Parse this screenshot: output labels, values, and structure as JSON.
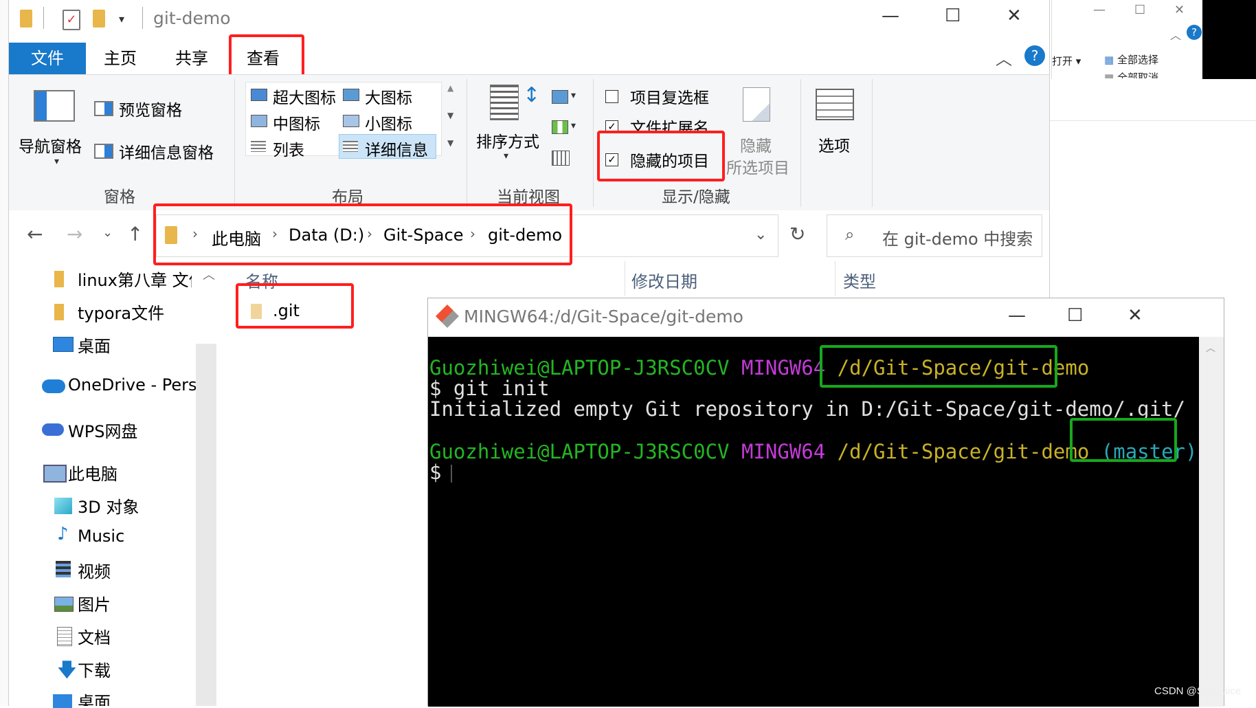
{
  "background_window": {
    "btn_open": "打开 ▾",
    "btn_select_all": "全部选择",
    "btn_deselect": "全部取消"
  },
  "explorer": {
    "title": "git-demo",
    "tabs": {
      "file": "文件",
      "home": "主页",
      "share": "共享",
      "view": "查看"
    },
    "ribbon": {
      "pane": {
        "nav_pane": "导航窗格",
        "preview_pane": "预览窗格",
        "details_pane": "详细信息窗格",
        "group_label": "窗格"
      },
      "layout": {
        "items": [
          "超大图标",
          "大图标",
          "中图标",
          "小图标",
          "列表",
          "详细信息"
        ],
        "group_label": "布局"
      },
      "current_view": {
        "sort_by": "排序方式",
        "group_label": "当前视图"
      },
      "show_hide": {
        "item_checkboxes": "项目复选框",
        "file_ext": "文件扩展名",
        "hidden_items": "隐藏的项目",
        "hide_selected_line1": "隐藏",
        "hide_selected_line2": "所选项目",
        "group_label": "显示/隐藏"
      },
      "options": {
        "label": "选项"
      }
    },
    "address": {
      "crumbs": [
        "此电脑",
        "Data (D:)",
        "Git-Space",
        "git-demo"
      ],
      "search_placeholder": "在 git-demo 中搜索"
    },
    "sidebar": {
      "items": [
        "linux第八章 文件",
        "typora文件",
        "桌面",
        "OneDrive - Perso",
        "WPS网盘",
        "此电脑",
        "3D 对象",
        "Music",
        "视频",
        "图片",
        "文档",
        "下载",
        "桌面"
      ]
    },
    "columns": {
      "name": "名称",
      "modified": "修改日期",
      "type": "类型"
    },
    "files": [
      {
        "name": ".git"
      }
    ]
  },
  "terminal": {
    "title": "MINGW64:/d/Git-Space/git-demo",
    "lines": {
      "prompt1_user": "Guozhiwei@LAPTOP-J3RSC0CV",
      "prompt1_env": "MINGW64",
      "prompt1_path": "/d/Git-Space/git-demo",
      "cmd1": "$ git init",
      "output1": "Initialized empty Git repository in D:/Git-Space/git-demo/.git/",
      "prompt2_user": "Guozhiwei@LAPTOP-J3RSC0CV",
      "prompt2_env": "MINGW64",
      "prompt2_path": "/d/Git-Space/git-demo",
      "prompt2_branch": "(master)",
      "cmd2": "$"
    }
  },
  "watermark": "CSDN @Saltyjuice",
  "colors": {
    "file_tab": "#1979ca",
    "highlight_red": "#ff1e1e",
    "highlight_green": "#17a81d",
    "term_user": "#23b623",
    "term_env": "#c23bd6",
    "term_path": "#c9b227",
    "term_branch": "#2aa8b8"
  }
}
